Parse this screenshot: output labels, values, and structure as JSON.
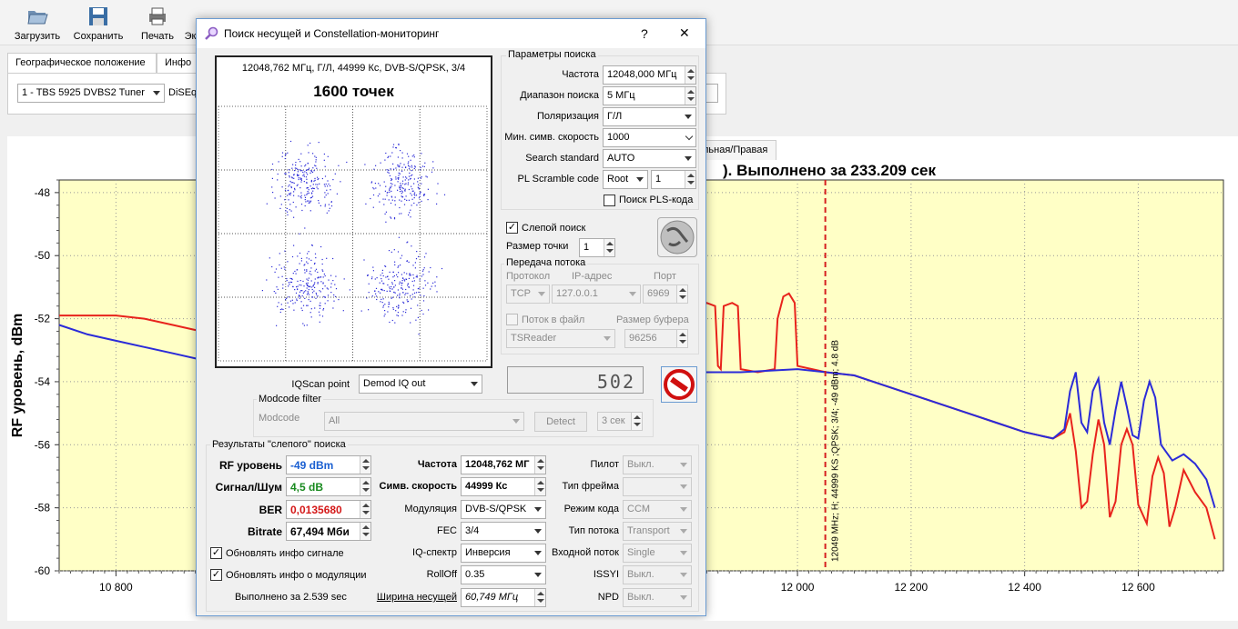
{
  "toolbar": {
    "load_label": "Загрузить",
    "save_label": "Сохранить",
    "print_label": "Печать",
    "export_label": "Эк"
  },
  "top_tabs": {
    "geo_label": "Географическое положение",
    "info_label": "Инфо"
  },
  "tuner": {
    "selected": "1 - TBS 5925 DVBS2 Tuner",
    "diseqc_label": "DiSEq"
  },
  "chart_tab_label": "льная/Правая",
  "chart_data": {
    "type": "line",
    "title": "). Выполнено за 233.209 сек",
    "ylabel": "RF уровень, dBm",
    "xlabel": "",
    "xlim": [
      10700,
      12750
    ],
    "ylim": [
      -60,
      -47.6
    ],
    "x_ticks": [
      "10 800",
      "12 000",
      "12 200",
      "12 400",
      "12 600"
    ],
    "x_tick_values": [
      10800,
      12000,
      12200,
      12400,
      12600
    ],
    "y_ticks": [
      "-48",
      "-50",
      "-52",
      "-54",
      "-56",
      "-58",
      "-60"
    ],
    "y_tick_values": [
      -48,
      -50,
      -52,
      -54,
      -56,
      -58,
      -60
    ],
    "marker": {
      "x": 12049,
      "label": "12049 MHz; H; 44999 KS ;QPSK; 3/4; -49 dBm; 4.8 dB"
    },
    "series": [
      {
        "color": "#e8231c",
        "points": [
          [
            10700,
            -51.9
          ],
          [
            10750,
            -51.9
          ],
          [
            10800,
            -51.9
          ],
          [
            10850,
            -52.0
          ],
          [
            10900,
            -52.2
          ],
          [
            10950,
            -52.4
          ],
          [
            11000,
            -52.6
          ],
          [
            11100,
            -52.8
          ],
          [
            11200,
            -53.0
          ],
          [
            11300,
            -53.2
          ],
          [
            11400,
            -53.3
          ],
          [
            11500,
            -53.5
          ],
          [
            11600,
            -53.6
          ],
          [
            11700,
            -53.7
          ],
          [
            11750,
            -53.8
          ],
          [
            11780,
            -54.1
          ],
          [
            11800,
            -54.1
          ],
          [
            11810,
            -53.9
          ],
          [
            11815,
            -52.2
          ],
          [
            11825,
            -51.6
          ],
          [
            11840,
            -51.5
          ],
          [
            11855,
            -51.6
          ],
          [
            11860,
            -53.5
          ],
          [
            11865,
            -53.6
          ],
          [
            11870,
            -51.6
          ],
          [
            11885,
            -51.5
          ],
          [
            11895,
            -51.6
          ],
          [
            11900,
            -53.6
          ],
          [
            11930,
            -53.7
          ],
          [
            11960,
            -53.6
          ],
          [
            11965,
            -52.0
          ],
          [
            11975,
            -51.3
          ],
          [
            11985,
            -51.2
          ],
          [
            11995,
            -51.5
          ],
          [
            12000,
            -53.5
          ],
          [
            12050,
            -53.7
          ],
          [
            12100,
            -53.8
          ],
          [
            12150,
            -54.1
          ],
          [
            12200,
            -54.4
          ],
          [
            12250,
            -54.7
          ],
          [
            12300,
            -55.0
          ],
          [
            12350,
            -55.3
          ],
          [
            12400,
            -55.6
          ],
          [
            12450,
            -55.8
          ],
          [
            12470,
            -55.6
          ],
          [
            12480,
            -55.0
          ],
          [
            12490,
            -56.2
          ],
          [
            12500,
            -58.0
          ],
          [
            12510,
            -57.8
          ],
          [
            12520,
            -56.3
          ],
          [
            12530,
            -55.2
          ],
          [
            12540,
            -56.0
          ],
          [
            12550,
            -58.3
          ],
          [
            12560,
            -57.8
          ],
          [
            12570,
            -56.0
          ],
          [
            12580,
            -55.5
          ],
          [
            12590,
            -56.0
          ],
          [
            12600,
            -57.9
          ],
          [
            12615,
            -58.5
          ],
          [
            12625,
            -57.0
          ],
          [
            12635,
            -56.4
          ],
          [
            12645,
            -56.9
          ],
          [
            12655,
            -58.6
          ],
          [
            12665,
            -58.0
          ],
          [
            12680,
            -56.8
          ],
          [
            12700,
            -57.5
          ],
          [
            12720,
            -58.0
          ],
          [
            12735,
            -59.0
          ]
        ]
      },
      {
        "color": "#2b2bd8",
        "points": [
          [
            10700,
            -52.2
          ],
          [
            10750,
            -52.5
          ],
          [
            10800,
            -52.7
          ],
          [
            10850,
            -52.9
          ],
          [
            10900,
            -53.1
          ],
          [
            10950,
            -53.3
          ],
          [
            11000,
            -53.4
          ],
          [
            11100,
            -53.5
          ],
          [
            11200,
            -53.6
          ],
          [
            11300,
            -53.6
          ],
          [
            11400,
            -53.7
          ],
          [
            11500,
            -53.7
          ],
          [
            11600,
            -53.8
          ],
          [
            11700,
            -53.8
          ],
          [
            11800,
            -53.7
          ],
          [
            11900,
            -53.7
          ],
          [
            12000,
            -53.6
          ],
          [
            12050,
            -53.7
          ],
          [
            12100,
            -53.8
          ],
          [
            12150,
            -54.1
          ],
          [
            12200,
            -54.4
          ],
          [
            12250,
            -54.7
          ],
          [
            12300,
            -55.0
          ],
          [
            12350,
            -55.3
          ],
          [
            12400,
            -55.6
          ],
          [
            12450,
            -55.8
          ],
          [
            12470,
            -55.5
          ],
          [
            12480,
            -54.3
          ],
          [
            12490,
            -53.7
          ],
          [
            12500,
            -55.3
          ],
          [
            12510,
            -55.6
          ],
          [
            12520,
            -54.3
          ],
          [
            12530,
            -53.9
          ],
          [
            12540,
            -55.3
          ],
          [
            12550,
            -56.0
          ],
          [
            12560,
            -54.9
          ],
          [
            12570,
            -54.0
          ],
          [
            12580,
            -54.8
          ],
          [
            12590,
            -55.7
          ],
          [
            12600,
            -55.8
          ],
          [
            12610,
            -54.6
          ],
          [
            12620,
            -54.0
          ],
          [
            12630,
            -54.5
          ],
          [
            12640,
            -56.0
          ],
          [
            12660,
            -56.5
          ],
          [
            12680,
            -56.3
          ],
          [
            12700,
            -56.6
          ],
          [
            12720,
            -57.1
          ],
          [
            12735,
            -58.0
          ]
        ]
      }
    ]
  },
  "dialog": {
    "title": "Поиск несущей и Constellation-мониторинг",
    "help_label": "?",
    "close_label": "✕",
    "constellation": {
      "info": "12048,762 МГц, Г/Л, 44999 Кс, DVB-S/QPSK, 3/4",
      "points_label": "1600 точек"
    },
    "search_params": {
      "title": "Параметры поиска",
      "freq_label": "Частота",
      "freq_value": "12048,000 МГц",
      "range_label": "Диапазон поиска",
      "range_value": "5 МГц",
      "pol_label": "Поляризация",
      "pol_value": "Г/Л",
      "minsr_label": "Мин. симв. скорость",
      "minsr_value": "1000",
      "standard_label": "Search standard",
      "standard_value": "AUTO",
      "pls_label": "PL Scramble code",
      "pls_mode": "Root",
      "pls_value": "1",
      "pls_search_label": "Поиск PLS-кода"
    },
    "blind_label": "Слепой поиск",
    "dot_size_label": "Размер точки",
    "dot_size_value": "1",
    "stream": {
      "title": "Передача потока",
      "protocol_label": "Протокол",
      "ip_label": "IP-адрес",
      "port_label": "Порт",
      "protocol_value": "TCP",
      "ip_value": "127.0.0.1",
      "port_value": "6969",
      "file_label": "Поток в файл",
      "buffer_label": "Размер буфера",
      "reader_value": "TSReader",
      "buffer_value": "96256"
    },
    "lcd_value": "502",
    "iqscan_label": "IQScan point",
    "iqscan_value": "Demod IQ out",
    "modcode": {
      "title": "Modcode filter",
      "label": "Modcode",
      "value": "All",
      "detect_label": "Detect",
      "time_value": "3 сек"
    },
    "results": {
      "title": "Результаты \"слепого\" поиска",
      "rf_label": "RF уровень",
      "rf_value": "-49 dBm",
      "snr_label": "Сигнал/Шум",
      "snr_value": "4,5 dB",
      "ber_label": "BER",
      "ber_value": "0,0135680",
      "bitrate_label": "Bitrate",
      "bitrate_value": "67,494 Мби",
      "freq_label": "Частота",
      "freq_value": "12048,762 МГ",
      "sr_label": "Симв. скорость",
      "sr_value": "44999 Кс",
      "mod_label": "Модуляция",
      "mod_value": "DVB-S/QPSK",
      "fec_label": "FEC",
      "fec_value": "3/4",
      "iq_label": "IQ-спектр",
      "iq_value": "Инверсия",
      "rolloff_label": "RollOff",
      "rolloff_value": "0.35",
      "bw_label": "Ширина несущей",
      "bw_value": "60,749 МГц",
      "pilot_label": "Пилот",
      "pilot_value": "Выкл.",
      "frame_label": "Тип фрейма",
      "frame_value": "",
      "codemode_label": "Режим кода",
      "codemode_value": "CCM",
      "streamtype_label": "Тип потока",
      "streamtype_value": "Transport",
      "instream_label": "Входной поток",
      "instream_value": "Single",
      "issyi_label": "ISSYI",
      "issyi_value": "Выкл.",
      "npd_label": "NPD",
      "npd_value": "Выкл.",
      "upd_signal_label": "Обновлять инфо сигнале",
      "upd_mod_label": "Обновлять инфо о модуляции",
      "done_label": "Выполнено за 2.539 sec"
    }
  }
}
